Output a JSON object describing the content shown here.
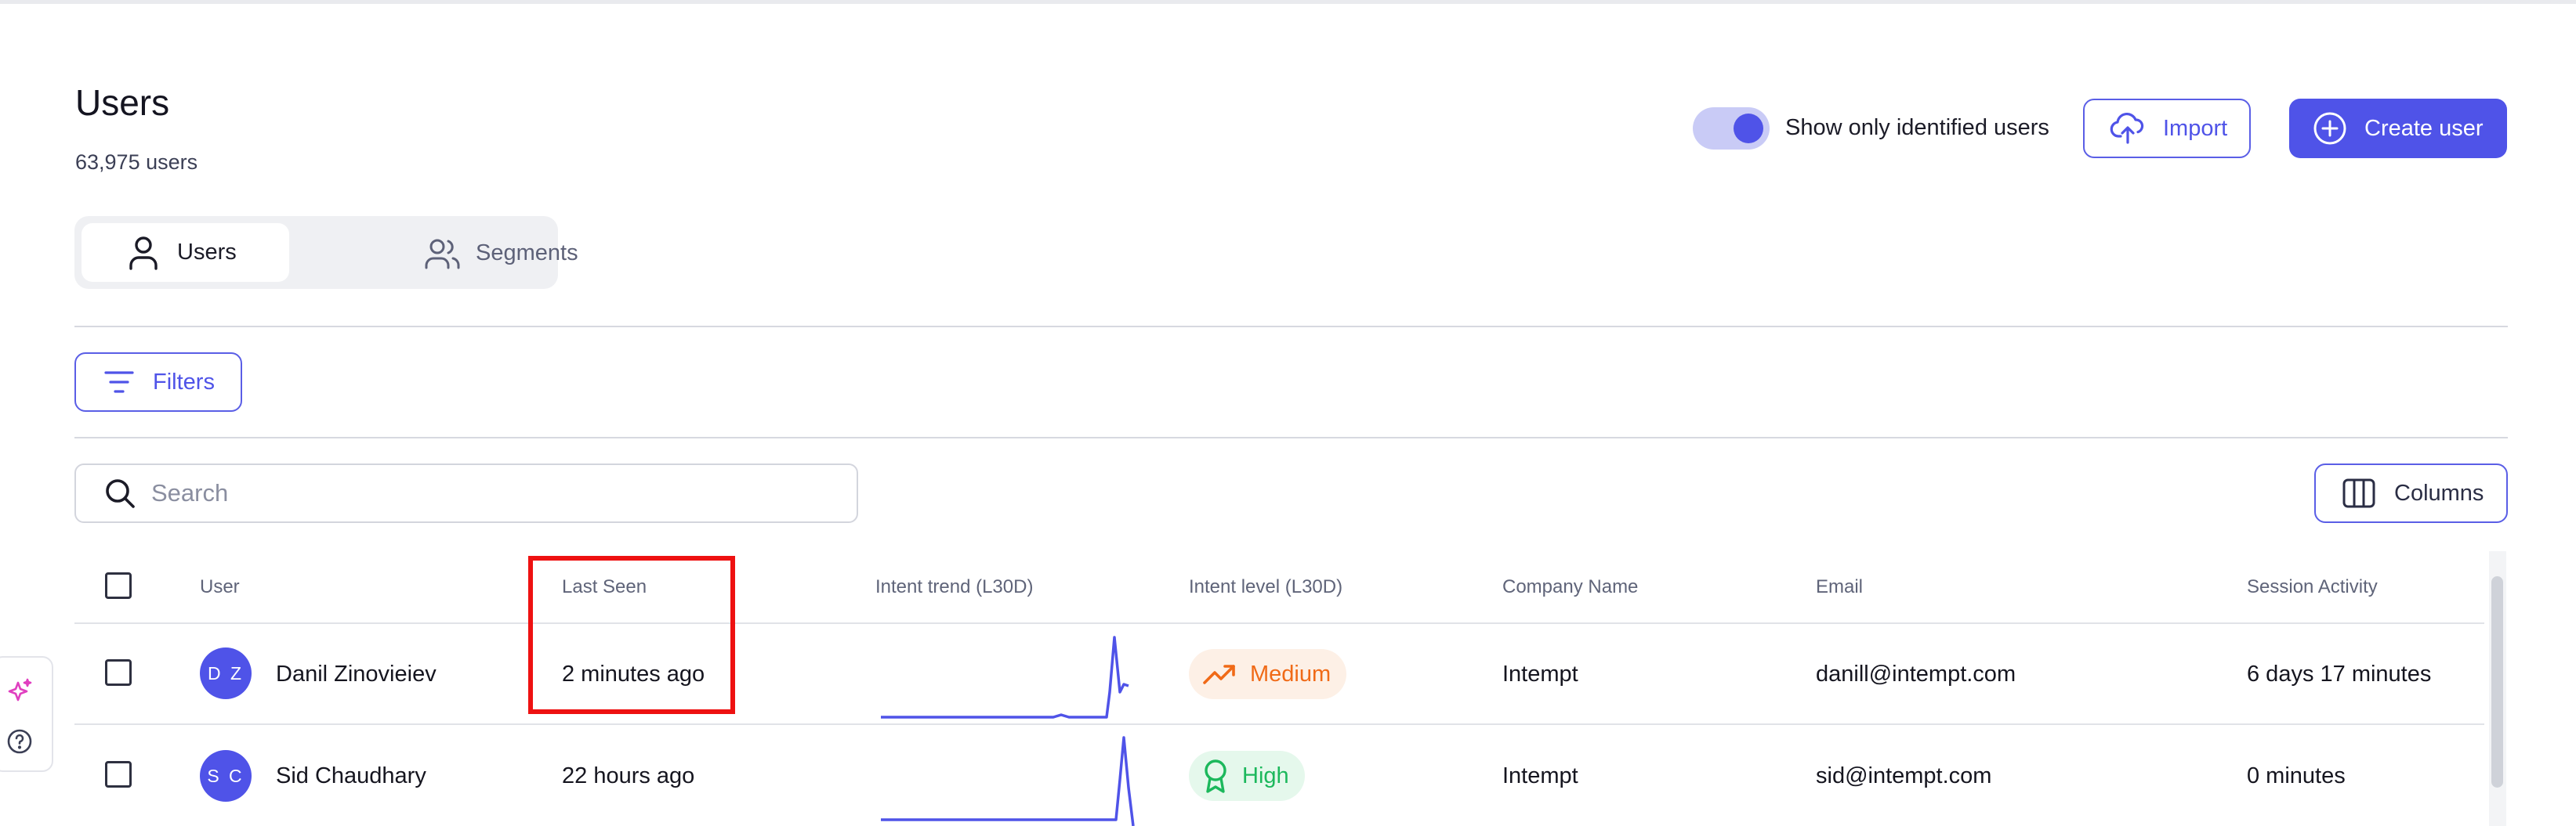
{
  "page": {
    "title": "Users",
    "count": "63,975 users"
  },
  "header": {
    "toggle_label": "Show only identified users",
    "toggle_on": true,
    "import_label": "Import",
    "create_label": "Create user"
  },
  "tabs": [
    {
      "label": "Users",
      "icon": "user-icon",
      "active": true
    },
    {
      "label": "Segments",
      "icon": "users-group-icon",
      "active": false
    }
  ],
  "filters_label": "Filters",
  "search": {
    "placeholder": "Search",
    "value": ""
  },
  "columns_label": "Columns",
  "table": {
    "headers": [
      "User",
      "Last Seen",
      "Intent trend (L30D)",
      "Intent level (L30D)",
      "Company Name",
      "Email",
      "Session Activity"
    ],
    "rows": [
      {
        "initials": "D Z",
        "name": "Danil Zinovieiev",
        "last_seen": "2 minutes ago",
        "intent_level": "Medium",
        "intent_icon": "trending-up-icon",
        "company": "Intempt",
        "email": "danill@intempt.com",
        "session_activity": "6 days 17 minutes"
      },
      {
        "initials": "S C",
        "name": "Sid Chaudhary",
        "last_seen": "22 hours ago",
        "intent_level": "High",
        "intent_icon": "award-icon",
        "company": "Intempt",
        "email": "sid@intempt.com",
        "session_activity": "0 minutes"
      }
    ]
  },
  "colors": {
    "accent": "#4f53e8",
    "medium": "#f06a17",
    "high": "#1cb85c",
    "highlight": "#ee1111"
  }
}
